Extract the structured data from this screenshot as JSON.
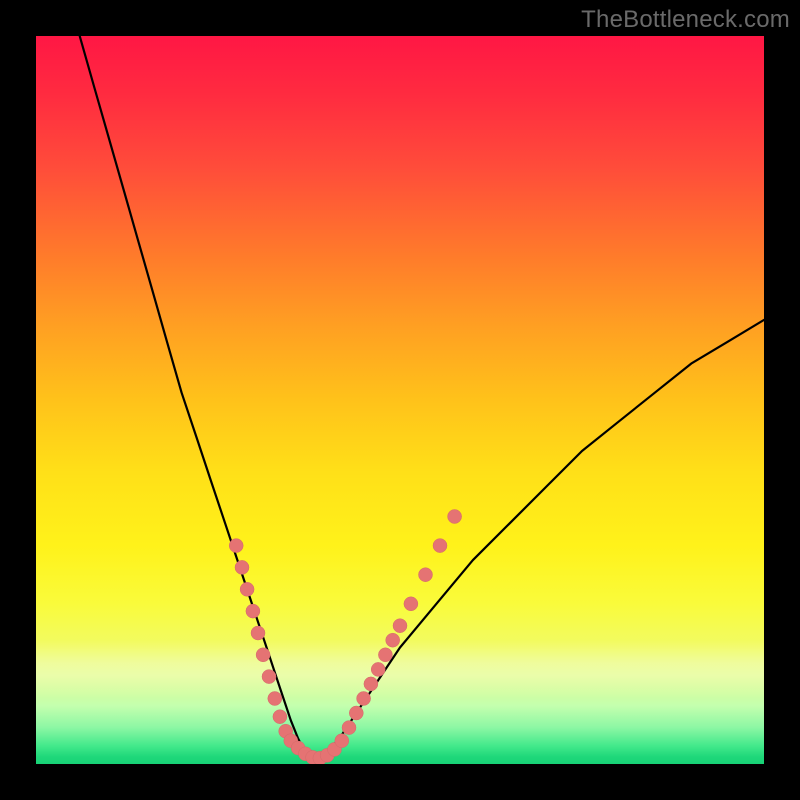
{
  "watermark": "TheBottleneck.com",
  "chart_data": {
    "type": "line",
    "title": "",
    "xlabel": "",
    "ylabel": "",
    "xlim": [
      0,
      100
    ],
    "ylim": [
      0,
      100
    ],
    "legend": false,
    "grid": false,
    "background_gradient": {
      "orientation": "vertical",
      "stops": [
        {
          "pos": 0.0,
          "color": "#ff1744"
        },
        {
          "pos": 0.3,
          "color": "#ff7a2b"
        },
        {
          "pos": 0.6,
          "color": "#ffe018"
        },
        {
          "pos": 0.85,
          "color": "#f1fb65"
        },
        {
          "pos": 0.97,
          "color": "#43e98b"
        },
        {
          "pos": 1.0,
          "color": "#17d276"
        }
      ]
    },
    "series": [
      {
        "name": "bottleneck-curve",
        "color": "#000000",
        "x": [
          6,
          8,
          10,
          12,
          14,
          16,
          18,
          20,
          22,
          24,
          26,
          28,
          30,
          32,
          33,
          34,
          35,
          36,
          37,
          38,
          39,
          40,
          42,
          44,
          46,
          48,
          50,
          55,
          60,
          65,
          70,
          75,
          80,
          85,
          90,
          95,
          100
        ],
        "y": [
          100,
          93,
          86,
          79,
          72,
          65,
          58,
          51,
          45,
          39,
          33,
          27,
          21,
          15,
          12,
          9,
          6,
          3.5,
          1.5,
          0.5,
          0.5,
          1.5,
          4,
          7,
          10,
          13,
          16,
          22,
          28,
          33,
          38,
          43,
          47,
          51,
          55,
          58,
          61
        ]
      }
    ],
    "markers": [
      {
        "name": "marker-cluster-left",
        "series": "bottleneck-curve",
        "points": [
          {
            "x": 27.5,
            "y": 30
          },
          {
            "x": 28.3,
            "y": 27
          },
          {
            "x": 29.0,
            "y": 24
          },
          {
            "x": 29.8,
            "y": 21
          },
          {
            "x": 30.5,
            "y": 18
          },
          {
            "x": 31.2,
            "y": 15
          },
          {
            "x": 32.0,
            "y": 12
          },
          {
            "x": 32.8,
            "y": 9
          },
          {
            "x": 33.5,
            "y": 6.5
          },
          {
            "x": 34.3,
            "y": 4.5
          }
        ]
      },
      {
        "name": "marker-cluster-bottom",
        "series": "bottleneck-curve",
        "points": [
          {
            "x": 35.0,
            "y": 3.2
          },
          {
            "x": 36.0,
            "y": 2.2
          },
          {
            "x": 37.0,
            "y": 1.4
          },
          {
            "x": 38.0,
            "y": 0.9
          },
          {
            "x": 39.0,
            "y": 0.8
          },
          {
            "x": 40.0,
            "y": 1.2
          },
          {
            "x": 41.0,
            "y": 2.0
          },
          {
            "x": 42.0,
            "y": 3.2
          }
        ]
      },
      {
        "name": "marker-cluster-right",
        "series": "bottleneck-curve",
        "points": [
          {
            "x": 43.0,
            "y": 5.0
          },
          {
            "x": 44.0,
            "y": 7.0
          },
          {
            "x": 45.0,
            "y": 9.0
          },
          {
            "x": 46.0,
            "y": 11.0
          },
          {
            "x": 47.0,
            "y": 13.0
          },
          {
            "x": 48.0,
            "y": 15.0
          },
          {
            "x": 49.0,
            "y": 17.0
          },
          {
            "x": 50.0,
            "y": 19.0
          },
          {
            "x": 51.5,
            "y": 22.0
          },
          {
            "x": 53.5,
            "y": 26.0
          },
          {
            "x": 55.5,
            "y": 30.0
          },
          {
            "x": 57.5,
            "y": 34.0
          }
        ]
      }
    ],
    "marker_style": {
      "shape": "circle",
      "radius": 7,
      "color": "#e57373"
    }
  }
}
